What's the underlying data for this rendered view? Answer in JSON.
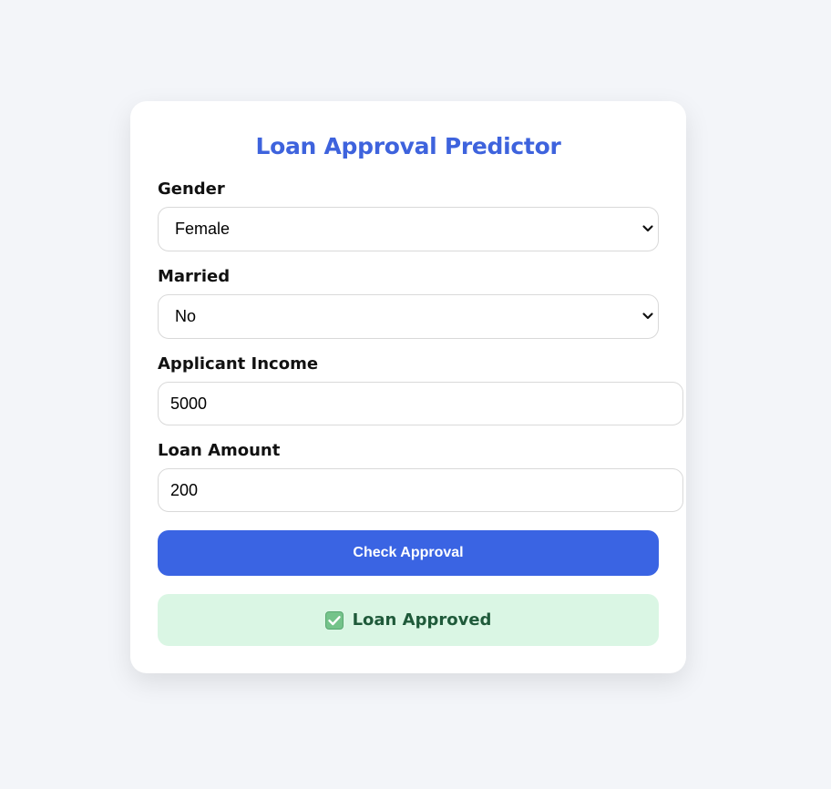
{
  "form": {
    "title": "Loan Approval Predictor",
    "fields": {
      "gender": {
        "label": "Gender",
        "value": "Female"
      },
      "married": {
        "label": "Married",
        "value": "No"
      },
      "applicant_income": {
        "label": "Applicant Income",
        "value": "5000"
      },
      "loan_amount": {
        "label": "Loan Amount",
        "value": "200"
      }
    },
    "submit_label": "Check Approval"
  },
  "result": {
    "icon": "check-mark-button-icon",
    "text": "Loan Approved",
    "colors": {
      "background": "#daf6e4",
      "text": "#1f5a3a"
    }
  },
  "colors": {
    "accent": "#3a64e3",
    "title": "#3e63dd",
    "page_background": "#f3f5f9"
  }
}
